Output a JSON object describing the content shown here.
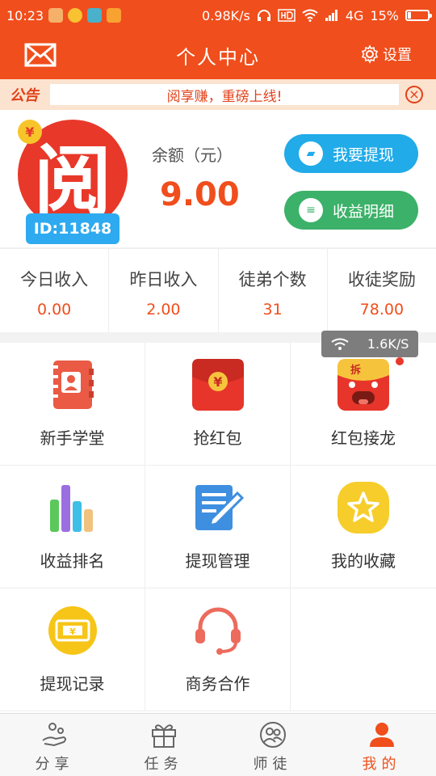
{
  "status_bar": {
    "time": "10:23",
    "network_speed": "0.98K/s",
    "network_type": "4G",
    "battery": "15%"
  },
  "header": {
    "title": "个人中心",
    "settings_label": "设置",
    "mail_icon": "mail-icon",
    "settings_icon": "gear-icon"
  },
  "notice": {
    "tag": "公告",
    "text": "阅享赚，重磅上线!"
  },
  "profile": {
    "avatar_glyph": "阅",
    "avatar_coin": "¥",
    "user_id": "ID:11848",
    "balance_label": "余额（元）",
    "balance_value": "9.00",
    "withdraw_label": "我要提现",
    "detail_label": "收益明细"
  },
  "stats": [
    {
      "label": "今日收入",
      "value": "0.00"
    },
    {
      "label": "昨日收入",
      "value": "2.00"
    },
    {
      "label": "徒弟个数",
      "value": "31"
    },
    {
      "label": "收徒奖励",
      "value": "78.00"
    }
  ],
  "speed_tooltip": "1.6K/S",
  "grid": [
    {
      "label": "新手学堂",
      "icon": "contact-book-icon"
    },
    {
      "label": "抢红包",
      "icon": "red-envelope-icon"
    },
    {
      "label": "红包接龙",
      "icon": "red-envelope-face-icon",
      "badge_text": "拆"
    },
    {
      "label": "收益排名",
      "icon": "bar-chart-icon"
    },
    {
      "label": "提现管理",
      "icon": "notepad-pen-icon"
    },
    {
      "label": "我的收藏",
      "icon": "star-icon"
    },
    {
      "label": "提现记录",
      "icon": "cash-bill-icon",
      "bill_text": "¥"
    },
    {
      "label": "商务合作",
      "icon": "headset-icon"
    }
  ],
  "envelope_coin": "¥",
  "bottom_nav": [
    {
      "label": "分享",
      "icon": "share-icon"
    },
    {
      "label": "任务",
      "icon": "gift-icon"
    },
    {
      "label": "师徒",
      "icon": "people-icon"
    },
    {
      "label": "我的",
      "icon": "person-icon",
      "active": true
    }
  ],
  "colors": {
    "brand": "#f04e1c",
    "withdraw": "#21abe8",
    "detail": "#3cb169"
  }
}
